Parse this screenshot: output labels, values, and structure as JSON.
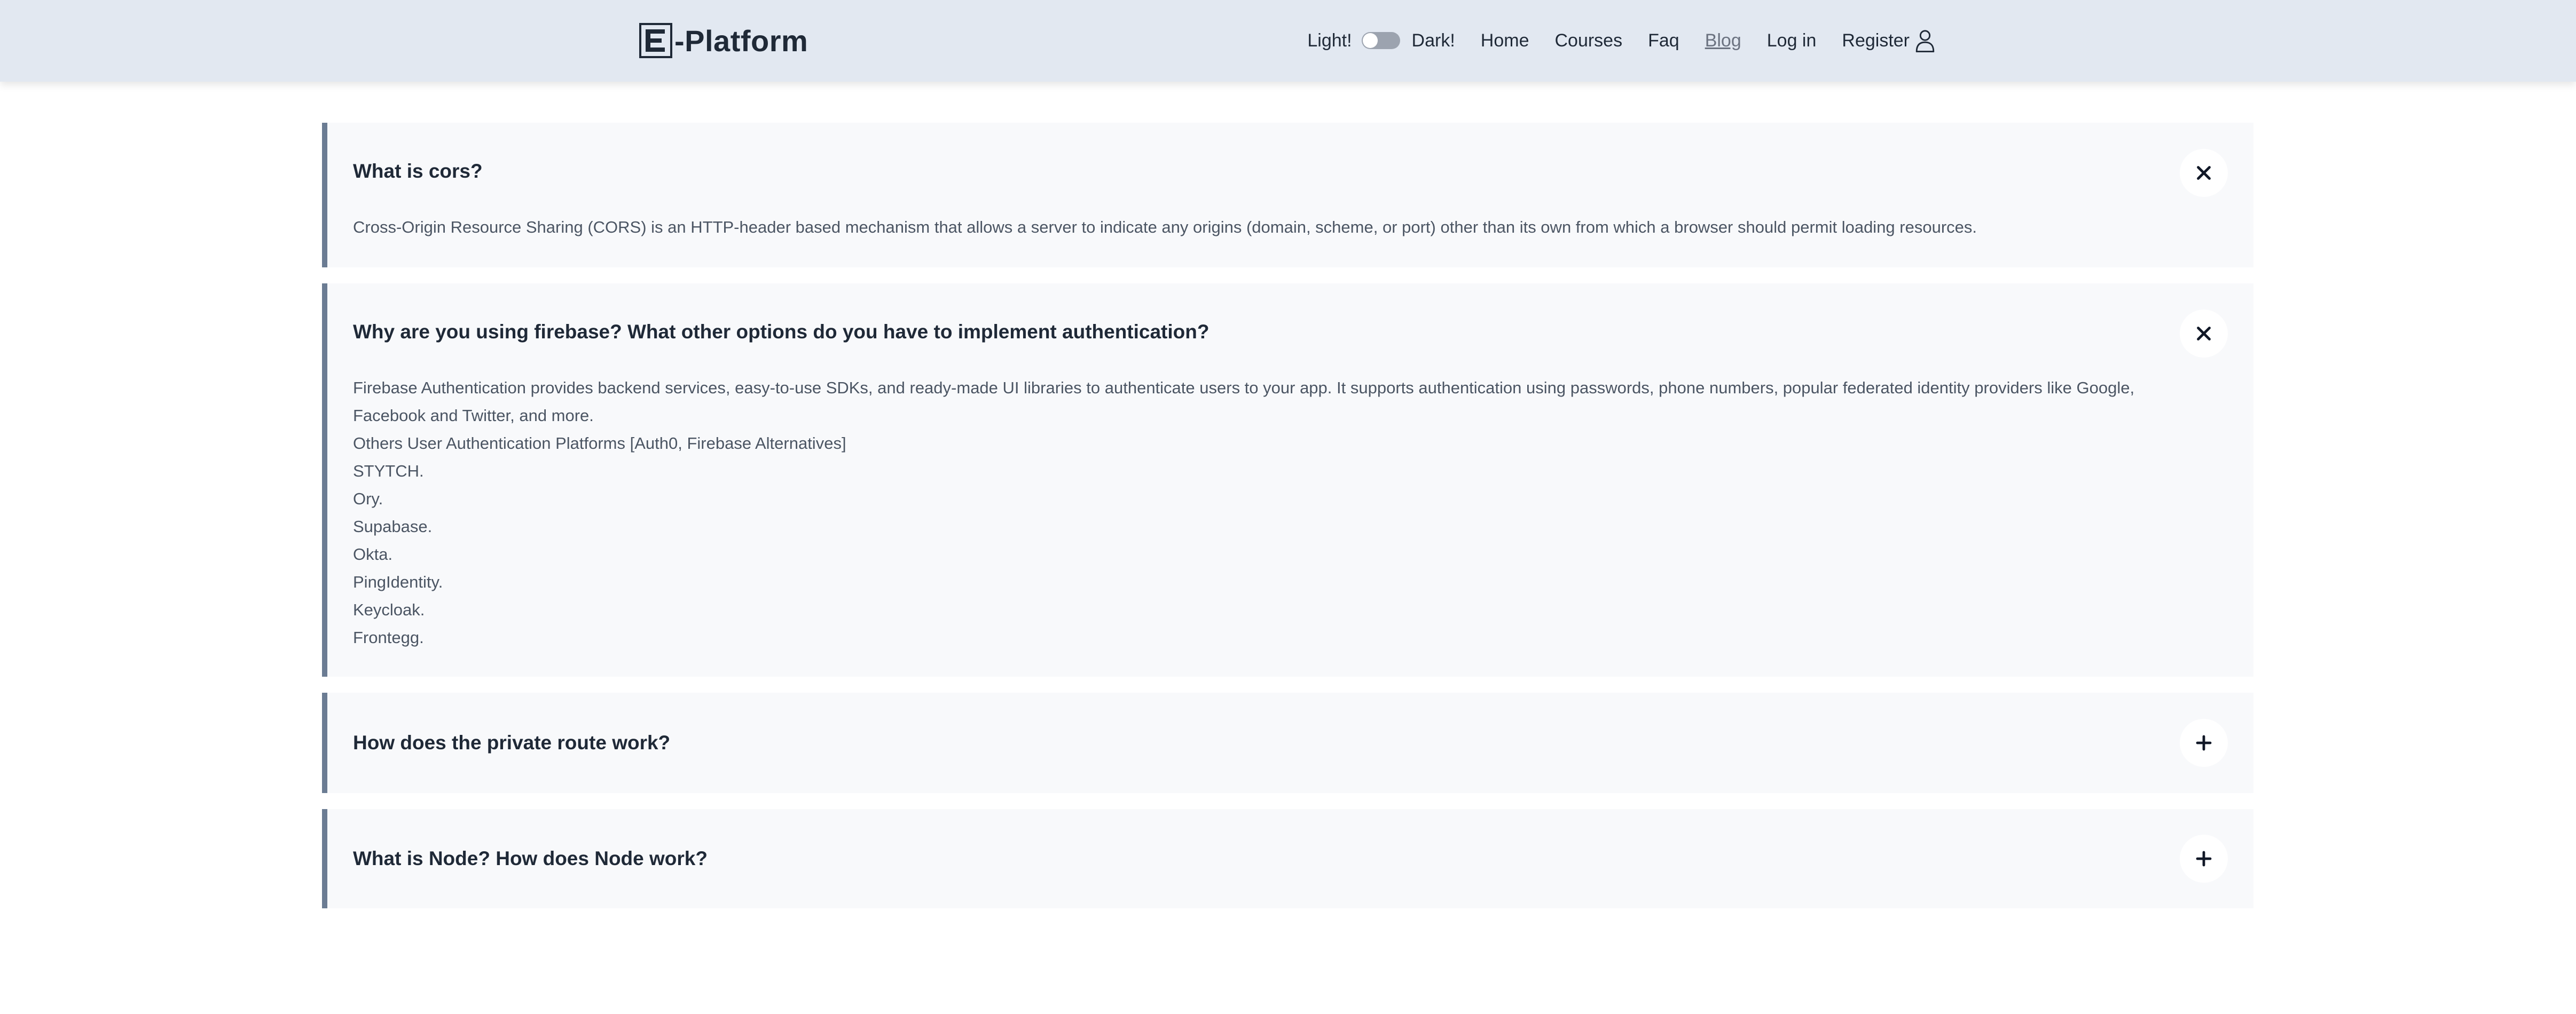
{
  "brand": {
    "name": "-Platform",
    "logo_letter": "E",
    "logo_icon": "E-box-logo-icon"
  },
  "theme": {
    "light_label": "Light!",
    "dark_label": "Dark!"
  },
  "nav": {
    "home": "Home",
    "courses": "Courses",
    "faq": "Faq",
    "blog": "Blog",
    "login": "Log in",
    "register": "Register",
    "register_icon": "user-icon"
  },
  "faqs": [
    {
      "question": "What is cors?",
      "expanded": true,
      "answer": [
        "Cross-Origin Resource Sharing (CORS) is an HTTP-header based mechanism that allows a server to indicate any origins (domain, scheme, or port) other than its own from which a browser should permit loading resources."
      ]
    },
    {
      "question": "Why are you using firebase? What other options do you have to implement authentication?",
      "expanded": true,
      "answer": [
        "Firebase Authentication provides backend services, easy-to-use SDKs, and ready-made UI libraries to authenticate users to your app. It supports authentication using passwords, phone numbers, popular federated identity providers like Google, Facebook and Twitter, and more.",
        "Others User Authentication Platforms [Auth0, Firebase Alternatives]",
        "STYTCH.",
        "Ory.",
        "Supabase.",
        "Okta.",
        "PingIdentity.",
        "Keycloak.",
        "Frontegg."
      ]
    },
    {
      "question": "How does the private route work?",
      "expanded": false
    },
    {
      "question": "What is Node? How does Node work?",
      "expanded": false
    }
  ],
  "colors": {
    "navbar": "#e2e8f1",
    "card": "#f8f9fb",
    "accent_border": "#6b7c93"
  }
}
